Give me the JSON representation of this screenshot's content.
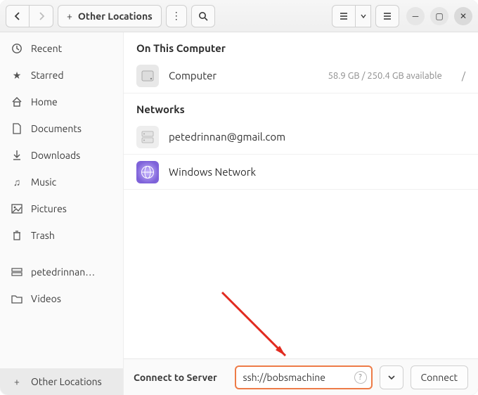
{
  "header": {
    "path_label": "Other Locations"
  },
  "sidebar": {
    "items": [
      {
        "icon": "clock",
        "label": "Recent"
      },
      {
        "icon": "star",
        "label": "Starred"
      },
      {
        "icon": "home",
        "label": "Home"
      },
      {
        "icon": "doc",
        "label": "Documents"
      },
      {
        "icon": "download",
        "label": "Downloads"
      },
      {
        "icon": "music",
        "label": "Music"
      },
      {
        "icon": "picture",
        "label": "Pictures"
      },
      {
        "icon": "trash",
        "label": "Trash"
      }
    ],
    "mounts": [
      {
        "icon": "drive",
        "label": "petedrinnan…"
      },
      {
        "icon": "folder",
        "label": "Videos"
      }
    ],
    "other_locations_label": "Other Locations"
  },
  "main": {
    "section_on_this_computer": "On This Computer",
    "computer_row": {
      "label": "Computer",
      "info": "58.9 GB / 250.4 GB available",
      "mount": "/"
    },
    "section_networks": "Networks",
    "network_rows": [
      {
        "icon": "server",
        "label": "petedrinnan@gmail.com"
      },
      {
        "icon": "network",
        "label": "Windows Network"
      }
    ]
  },
  "footer": {
    "label": "Connect to Server",
    "address_value": "ssh://bobsmachine",
    "connect_label": "Connect"
  },
  "colors": {
    "highlight": "#ed7b47",
    "arrow": "#e12a1f"
  }
}
